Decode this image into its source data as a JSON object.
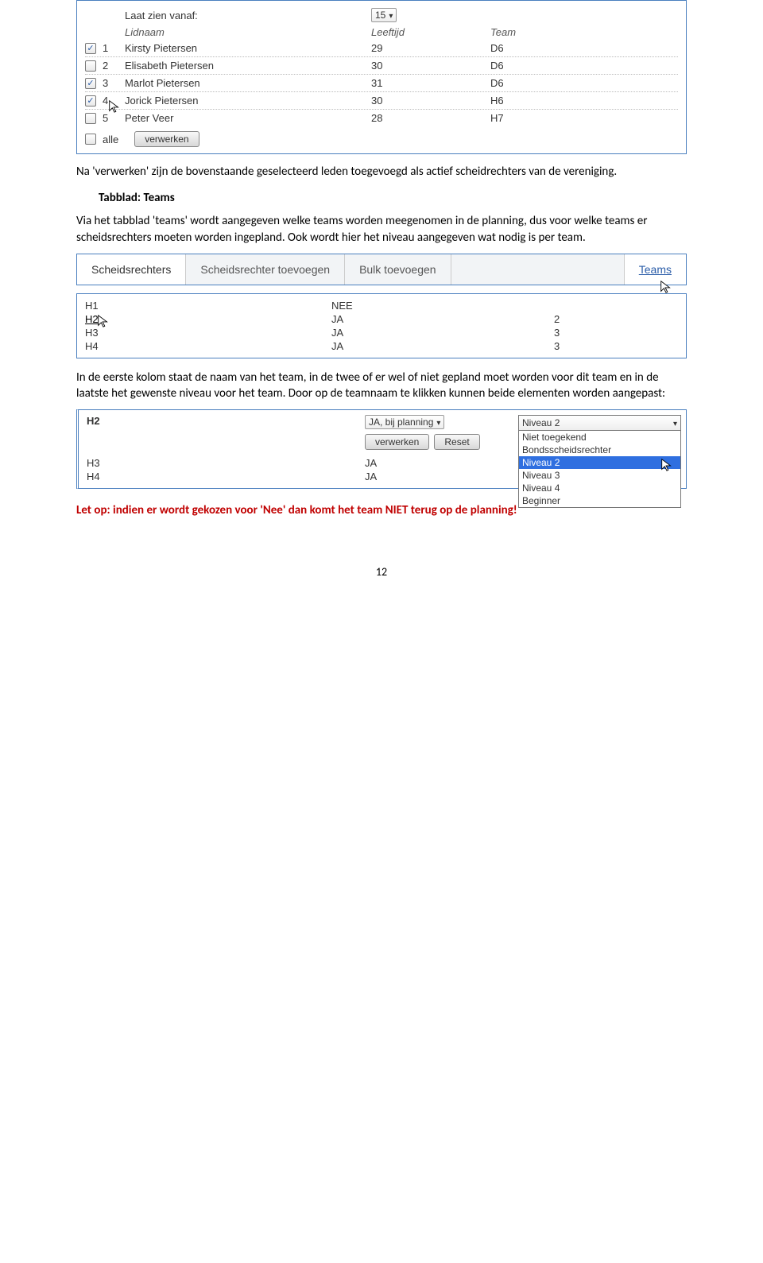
{
  "panel1": {
    "show_from_label": "Laat zien vanaf:",
    "show_from_value": "15",
    "col_name": "Lidnaam",
    "col_age": "Leeftijd",
    "col_team": "Team",
    "rows": [
      {
        "checked": true,
        "num": "1",
        "name": "Kirsty Pietersen",
        "age": "29",
        "team": "D6"
      },
      {
        "checked": false,
        "num": "2",
        "name": "Elisabeth Pietersen",
        "age": "30",
        "team": "D6"
      },
      {
        "checked": true,
        "num": "3",
        "name": "Marlot Pietersen",
        "age": "31",
        "team": "D6"
      },
      {
        "checked": true,
        "num": "4",
        "name": "Jorick Pietersen",
        "age": "30",
        "team": "H6",
        "cursor": true
      },
      {
        "checked": false,
        "num": "5",
        "name": "Peter Veer",
        "age": "28",
        "team": "H7"
      }
    ],
    "all_label": "alle",
    "process_label": "verwerken"
  },
  "text": {
    "p1": "Na 'verwerken' zijn de bovenstaande geselecteerd leden toegevoegd als actief scheidrechters van de vereniging.",
    "h1": "Tabblad: Teams",
    "p2": "Via het tabblad 'teams' wordt aangegeven welke teams worden meegenomen in de planning, dus voor welke teams er scheidsrechters moeten worden ingepland. Ook wordt hier het niveau aangegeven wat nodig is per team.",
    "p3": "In de eerste kolom staat de naam van het team, in de twee of er wel of niet gepland moet worden voor dit team en in de laatste het gewenste niveau voor het team. Door op de teamnaam te klikken kunnen beide elementen worden aangepast:",
    "warn": "Let op: indien er wordt gekozen voor 'Nee' dan komt het team NIET terug op de planning!"
  },
  "tabs": {
    "t1": "Scheidsrechters",
    "t2": "Scheidsrechter toevoegen",
    "t3": "Bulk toevoegen",
    "t4": "Teams"
  },
  "team_table": {
    "rows": [
      {
        "name": "H1",
        "plan": "NEE",
        "level": ""
      },
      {
        "name": "H2",
        "plan": "JA",
        "level": "2",
        "cursor": true
      },
      {
        "name": "H3",
        "plan": "JA",
        "level": "3"
      },
      {
        "name": "H4",
        "plan": "JA",
        "level": "3"
      }
    ]
  },
  "edit": {
    "team": "H2",
    "plan_value": "JA, bij planning",
    "process": "verwerken",
    "reset": "Reset",
    "dd_current": "Niveau 2",
    "dd_options": [
      "Niet toegekend",
      "Bondsscheidsrechter",
      "Niveau 2",
      "Niveau 3",
      "Niveau 4",
      "Beginner"
    ],
    "row1_name": "H3",
    "row1_plan": "JA",
    "row2_name": "H4",
    "row2_plan": "JA"
  },
  "page": "12"
}
